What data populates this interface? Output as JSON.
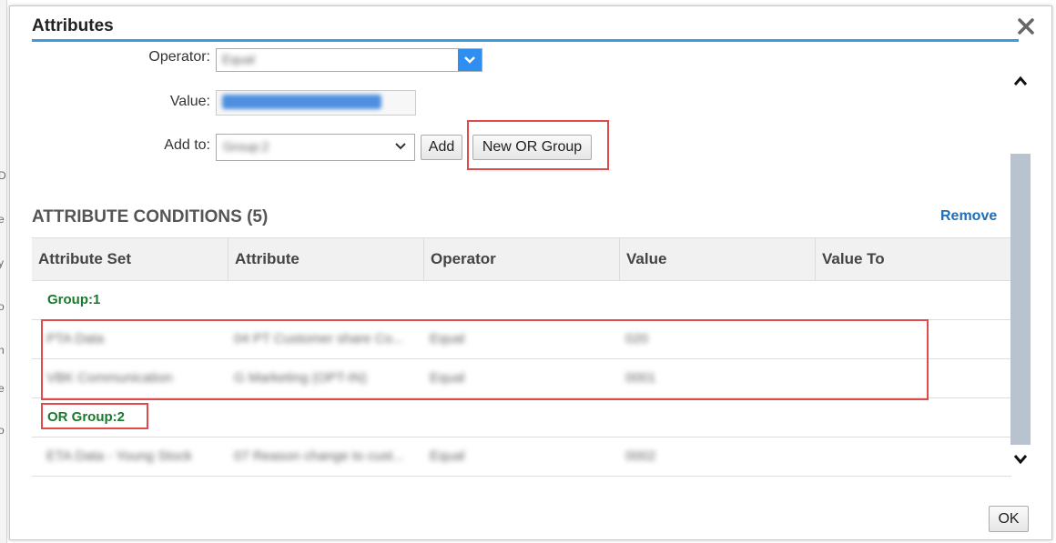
{
  "dialog": {
    "title": "Attributes",
    "close_icon": "close-icon"
  },
  "form": {
    "operator_label": "Operator:",
    "operator_value": "Equal",
    "value_label": "Value:",
    "add_to_label": "Add to:",
    "add_to_value": "Group:2",
    "add_button": "Add",
    "new_or_group_button": "New OR Group"
  },
  "conditions": {
    "title": "ATTRIBUTE CONDITIONS (5)",
    "remove_link": "Remove",
    "columns": [
      "Attribute Set",
      "Attribute",
      "Operator",
      "Value",
      "Value To"
    ],
    "groups": [
      {
        "label": "Group:1",
        "rows": [
          {
            "attribute_set": "PTA Data",
            "attribute": "04 PT Customer share Co...",
            "operator": "Equal",
            "value": "020",
            "value_to": ""
          },
          {
            "attribute_set": "VBK Communication",
            "attribute": "G Marketing (OPT-IN)",
            "operator": "Equal",
            "value": "0001",
            "value_to": ""
          }
        ]
      },
      {
        "label": "OR Group:2",
        "rows": [
          {
            "attribute_set": "ETA Data - Young Stock",
            "attribute": "07 Reason change to cust...",
            "operator": "Equal",
            "value": "0002",
            "value_to": ""
          }
        ]
      }
    ]
  },
  "footer": {
    "ok_button": "OK"
  },
  "colors": {
    "accent": "#3b9ae1",
    "group_green": "#197a2f",
    "link_blue": "#1f6fb6",
    "highlight_red": "#e04a4a"
  }
}
